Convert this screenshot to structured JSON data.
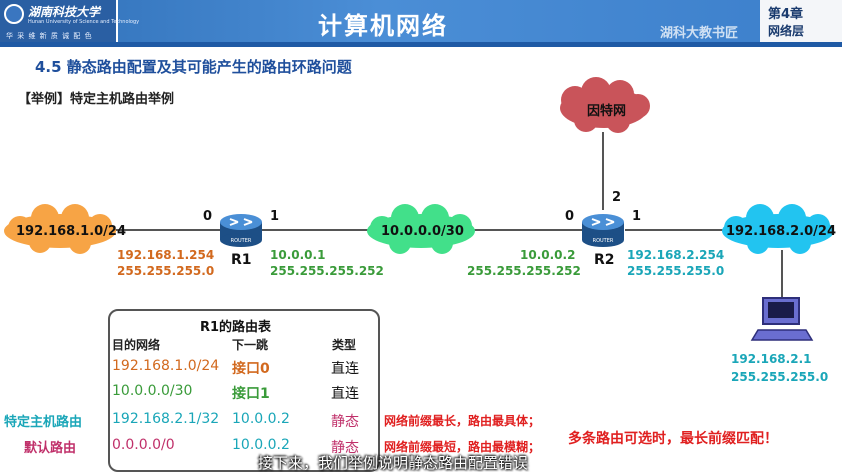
{
  "header": {
    "logo_name": "湖南科技大学",
    "logo_en": "Hunan University of Science and Technology",
    "logo_motto": "华 采 维 新   质 诚 配 色",
    "course_title": "计算机网络",
    "chapter": "第4章",
    "chapter_sub": "网络层",
    "watermark": "湖科大教书匠"
  },
  "section_title": "4.5  静态路由配置及其可能产生的路由环路问题",
  "example_label": "【举例】特定主机路由举例",
  "network": {
    "internet_label": "因特网",
    "net_left": "192.168.1.0/24",
    "net_mid": "10.0.0.0/30",
    "net_right": "192.168.2.0/24",
    "r1": {
      "name": "R1",
      "port0": "0",
      "port1": "1",
      "if0_ip": "192.168.1.254",
      "if0_mask": "255.255.255.0",
      "if1_ip": "10.0.0.1",
      "if1_mask": "255.255.255.252"
    },
    "r2": {
      "name": "R2",
      "port0": "0",
      "port1": "1",
      "port2": "2",
      "if0_ip": "10.0.0.2",
      "if0_mask": "255.255.255.252",
      "if1_ip": "192.168.2.254",
      "if1_mask": "255.255.255.0"
    },
    "router_caption": "ROUTER",
    "host_ip": "192.168.2.1",
    "host_mask": "255.255.255.0"
  },
  "routing_table": {
    "title": "R1的路由表",
    "headers": [
      "目的网络",
      "下一跳",
      "类型"
    ],
    "rows": [
      {
        "dest": "192.168.1.0/24",
        "next": "接口0",
        "type": "直连"
      },
      {
        "dest": "10.0.0.0/30",
        "next": "接口1",
        "type": "直连"
      },
      {
        "dest": "192.168.2.1/32",
        "next": "10.0.0.2",
        "type": "静态"
      },
      {
        "dest": "0.0.0.0/0",
        "next": "10.0.0.2",
        "type": "静态"
      }
    ]
  },
  "side_labels": {
    "host_route": "特定主机路由",
    "default_route": "默认路由"
  },
  "notes": {
    "longest": "网络前缀最长，路由最具体；",
    "shortest": "网络前缀最短，路由最模糊；",
    "match_rule": "多条路由可选时，最长前缀匹配！"
  },
  "subtitle": "接下来，我们举例说明静态路由配置错误",
  "colors": {
    "header_blue": "#2f6fb7",
    "cloud_orange": "#f7a445",
    "cloud_green": "#42e08a",
    "cloud_blue": "#22c4f0",
    "cloud_red": "#c9545a",
    "router_blue": "#2e6fb3"
  }
}
